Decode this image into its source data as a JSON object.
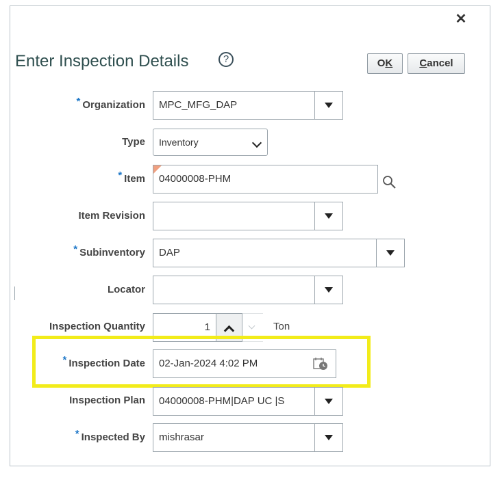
{
  "dialog": {
    "title": "Enter Inspection Details",
    "help_glyph": "?",
    "ok": {
      "accesskey": "K",
      "pre": "O",
      "post": ""
    },
    "cancel": {
      "accesskey": "C",
      "pre": "",
      "post": "ancel"
    }
  },
  "fields": {
    "organization": {
      "label": "Organization",
      "value": "MPC_MFG_DAP"
    },
    "type": {
      "label": "Type",
      "value": "Inventory"
    },
    "item": {
      "label": "Item",
      "value": "04000008-PHM"
    },
    "item_revision": {
      "label": "Item Revision",
      "value": ""
    },
    "subinventory": {
      "label": "Subinventory",
      "value": "DAP"
    },
    "locator": {
      "label": "Locator",
      "value": ""
    },
    "inspection_quantity": {
      "label": "Inspection Quantity",
      "value": "1",
      "uom": "Ton"
    },
    "inspection_date": {
      "label": "Inspection Date",
      "value": "02-Jan-2024 4:02 PM"
    },
    "inspection_plan": {
      "label": "Inspection Plan",
      "value": "04000008-PHM|DAP UC |S"
    },
    "inspected_by": {
      "label": "Inspected By",
      "value": "mishrasar"
    }
  },
  "required_mark": "*",
  "colors": {
    "title": "#2f4f4f",
    "required": "#1f78c8",
    "highlight": "#f2ec1a"
  },
  "icons": [
    "close-icon",
    "help-icon",
    "search-icon",
    "calendar-icon",
    "dropdown-icon",
    "chevron-down-icon"
  ]
}
